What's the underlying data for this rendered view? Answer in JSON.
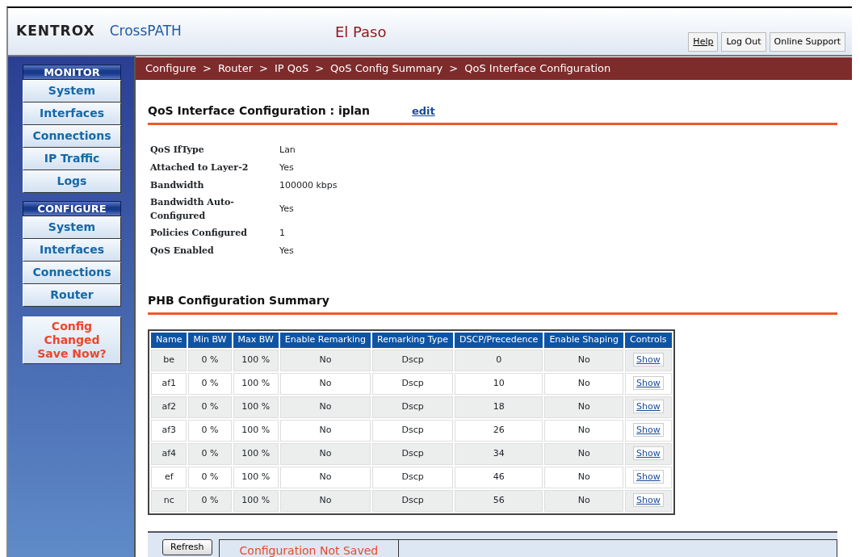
{
  "header": {
    "logo": "KENTROX",
    "product": "CrossPATH",
    "site": "El Paso",
    "buttons": [
      {
        "label": "Help",
        "kind": "link"
      },
      {
        "label": "Log Out",
        "kind": "button"
      },
      {
        "label": "Online Support",
        "kind": "button"
      }
    ]
  },
  "sidebar": {
    "sections": [
      {
        "title": "MONITOR",
        "items": [
          "System",
          "Interfaces",
          "Connections",
          "IP Traffic",
          "Logs"
        ]
      },
      {
        "title": "CONFIGURE",
        "items": [
          "System",
          "Interfaces",
          "Connections",
          "Router"
        ]
      }
    ],
    "alert": [
      "Config Changed",
      "Save Now?"
    ]
  },
  "breadcrumb": {
    "separator": ">",
    "items": [
      "Configure",
      "Router",
      "IP QoS",
      "QoS Config Summary",
      "QoS Interface Configuration"
    ]
  },
  "interface": {
    "title": "QoS Interface Configuration : iplan",
    "edit_link": "edit",
    "fields": [
      {
        "label": "QoS IfType",
        "value": "Lan"
      },
      {
        "label": "Attached to Layer-2",
        "value": "Yes"
      },
      {
        "label": "Bandwidth",
        "value": "100000 kbps"
      },
      {
        "label": "Bandwidth Auto-Configured",
        "value": "Yes"
      },
      {
        "label": "Policies Configured",
        "value": "1"
      },
      {
        "label": "QoS Enabled",
        "value": "Yes"
      }
    ]
  },
  "phb": {
    "title": "PHB Configuration Summary",
    "columns": [
      "Name",
      "Min BW",
      "Max BW",
      "Enable Remarking",
      "Remarking Type",
      "DSCP/Precedence",
      "Enable Shaping",
      "Controls"
    ],
    "rows": [
      [
        "be",
        "0 %",
        "100 %",
        "No",
        "Dscp",
        "0",
        "No",
        "Show"
      ],
      [
        "af1",
        "0 %",
        "100 %",
        "No",
        "Dscp",
        "10",
        "No",
        "Show"
      ],
      [
        "af2",
        "0 %",
        "100 %",
        "No",
        "Dscp",
        "18",
        "No",
        "Show"
      ],
      [
        "af3",
        "0 %",
        "100 %",
        "No",
        "Dscp",
        "26",
        "No",
        "Show"
      ],
      [
        "af4",
        "0 %",
        "100 %",
        "No",
        "Dscp",
        "34",
        "No",
        "Show"
      ],
      [
        "ef",
        "0 %",
        "100 %",
        "No",
        "Dscp",
        "46",
        "No",
        "Show"
      ],
      [
        "nc",
        "0 %",
        "100 %",
        "No",
        "Dscp",
        "56",
        "No",
        "Show"
      ]
    ]
  },
  "footer": {
    "button": "Refresh",
    "status": "Configuration Not Saved"
  }
}
